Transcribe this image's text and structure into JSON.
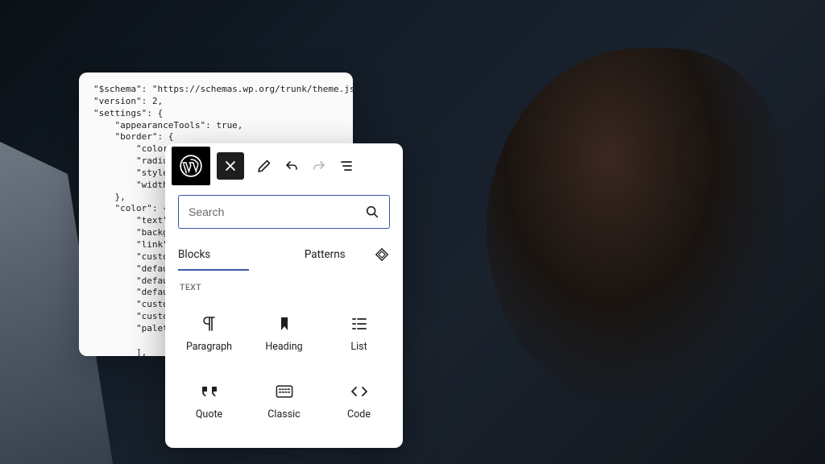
{
  "code_panel": {
    "text": "\"$schema\": \"https://schemas.wp.org/trunk/theme.json\",\n\"version\": 2,\n\"settings\": {\n    \"appearanceTools\": true,\n    \"border\": {\n        \"color\": false,\n        \"radius\": false,\n        \"style\": false,\n        \"width\": false\n    },\n    \"color\": {\n        \"text\": true,\n        \"background\": true,\n        \"link\": true,\n        \"custom\": true,\n        \"default\": true,\n        \"defaultGradients\": true,\n        \"defaultPalette\": true,\n        \"customDuotone\": true,\n        \"customGradient\": true,\n        \"palette\": [\n\n        ],\n        \"gradients\": [\n\n        ]\n    },\n    \"spacing\": {\n        \"margin\": true,\n        \"padding\": true,\n        \"units\": [\"px\",\"em\",\"rem\",\"vh\",\"vw\",\"%\"]\n    }"
  },
  "search": {
    "placeholder": "Search"
  },
  "tabs": {
    "blocks": "Blocks",
    "patterns": "Patterns"
  },
  "section": {
    "text": "TEXT"
  },
  "blocks": {
    "paragraph": "Paragraph",
    "heading": "Heading",
    "list": "List",
    "quote": "Quote",
    "classic": "Classic",
    "code": "Code"
  }
}
